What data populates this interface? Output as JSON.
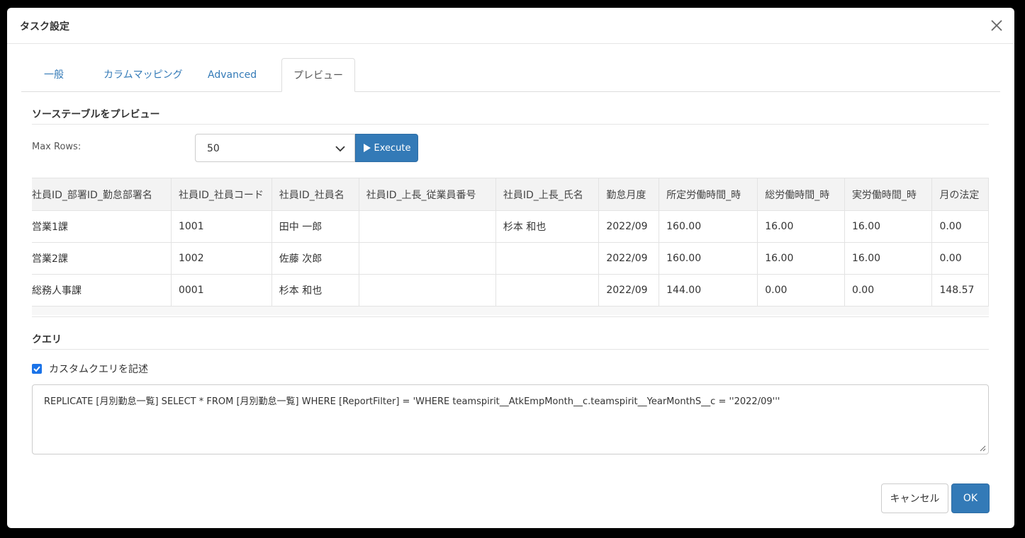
{
  "dialog": {
    "title": "タスク設定"
  },
  "tabs": [
    {
      "label": "一般",
      "active": false
    },
    {
      "label": "カラムマッピング",
      "active": false
    },
    {
      "label": "Advanced",
      "active": false
    },
    {
      "label": "プレビュー",
      "active": true
    }
  ],
  "preview": {
    "section_title": "ソーステーブルをプレビュー",
    "max_rows_label": "Max Rows:",
    "max_rows_value": "50",
    "execute_label": "Execute"
  },
  "grid": {
    "columns": [
      "社員ID_部署ID_勤怠部署名",
      "社員ID_社員コード",
      "社員ID_社員名",
      "社員ID_上長_従業員番号",
      "社員ID_上長_氏名",
      "勤怠月度",
      "所定労働時間_時",
      "総労働時間_時",
      "実労働時間_時",
      "月の法定"
    ],
    "rows": [
      [
        "営業1課",
        "1001",
        "田中 一郎",
        "",
        "杉本 和也",
        "2022/09",
        "160.00",
        "16.00",
        "16.00",
        "0.00"
      ],
      [
        "営業2課",
        "1002",
        "佐藤 次郎",
        "",
        "",
        "2022/09",
        "160.00",
        "16.00",
        "16.00",
        "0.00"
      ],
      [
        "総務人事課",
        "0001",
        "杉本 和也",
        "",
        "",
        "2022/09",
        "144.00",
        "0.00",
        "0.00",
        "148.57"
      ]
    ]
  },
  "query": {
    "section_title": "クエリ",
    "custom_query_label": "カスタムクエリを記述",
    "custom_query_checked": true,
    "text": "REPLICATE [月別勤怠一覧] SELECT * FROM [月別勤怠一覧] WHERE [ReportFilter] = 'WHERE teamspirit__AtkEmpMonth__c.teamspirit__YearMonthS__c = ''2022/09'''"
  },
  "footer": {
    "cancel_label": "キャンセル",
    "ok_label": "OK"
  },
  "colors": {
    "primary": "#337ab7",
    "link": "#337ab7",
    "checkbox": "#1a73e8"
  },
  "icons": {
    "close": "close-icon",
    "chevron": "chevron-down-icon",
    "play": "play-icon",
    "check": "checkmark-icon"
  }
}
